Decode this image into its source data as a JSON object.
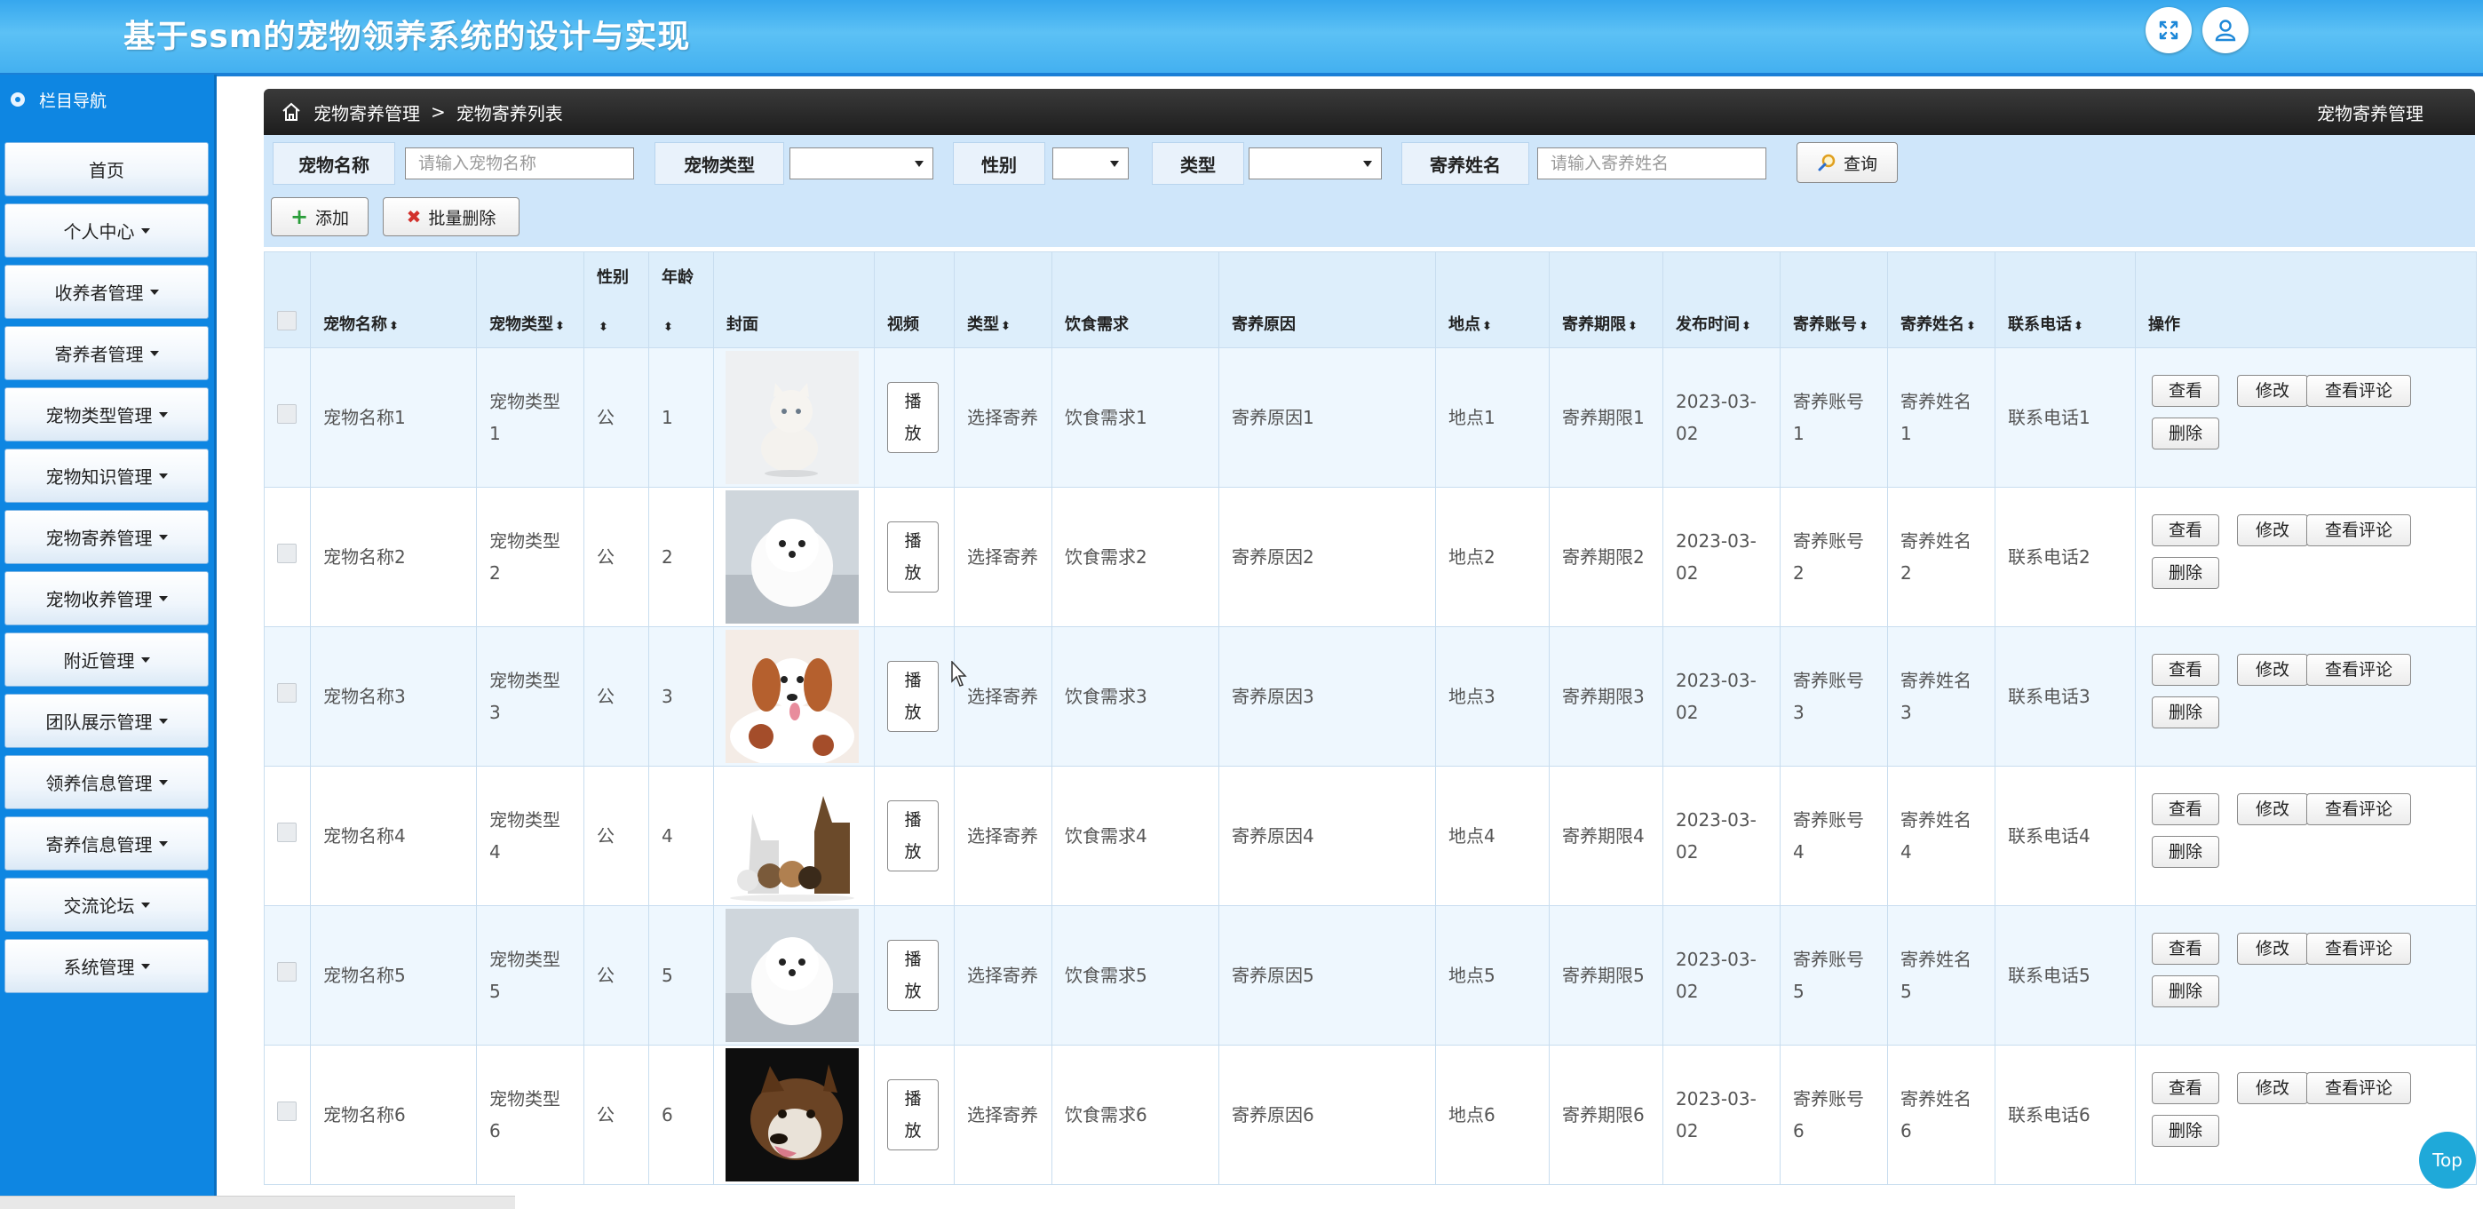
{
  "app": {
    "title": "基于ssm的宠物领养系统的设计与实现"
  },
  "sidebar": {
    "header": "栏目导航",
    "items": [
      {
        "label": "首页",
        "has_caret": false
      },
      {
        "label": "个人中心",
        "has_caret": true
      },
      {
        "label": "收养者管理",
        "has_caret": true
      },
      {
        "label": "寄养者管理",
        "has_caret": true
      },
      {
        "label": "宠物类型管理",
        "has_caret": true
      },
      {
        "label": "宠物知识管理",
        "has_caret": true
      },
      {
        "label": "宠物寄养管理",
        "has_caret": true
      },
      {
        "label": "宠物收养管理",
        "has_caret": true
      },
      {
        "label": "附近管理",
        "has_caret": true
      },
      {
        "label": "团队展示管理",
        "has_caret": true
      },
      {
        "label": "领养信息管理",
        "has_caret": true
      },
      {
        "label": "寄养信息管理",
        "has_caret": true
      },
      {
        "label": "交流论坛",
        "has_caret": true
      },
      {
        "label": "系统管理",
        "has_caret": true
      }
    ]
  },
  "breadcrumb": {
    "section": "宠物寄养管理",
    "separator": ">",
    "page": "宠物寄养列表",
    "right_title": "宠物寄养管理"
  },
  "search": {
    "pet_name_label": "宠物名称",
    "pet_name_placeholder": "请输入宠物名称",
    "pet_type_label": "宠物类型",
    "pet_type_value": "",
    "gender_label": "性别",
    "gender_value": "",
    "type_label": "类型",
    "type_value": "",
    "owner_name_label": "寄养姓名",
    "owner_name_placeholder": "请输入寄养姓名",
    "query_button": "查询"
  },
  "toolbar": {
    "add_button": "添加",
    "batch_delete_button": "批量删除"
  },
  "table": {
    "headers": {
      "pet_name": "宠物名称",
      "pet_type": "宠物类型",
      "gender": "性别",
      "age": "年龄",
      "cover": "封面",
      "video": "视频",
      "type": "类型",
      "diet": "饮食需求",
      "reason": "寄养原因",
      "location": "地点",
      "period": "寄养期限",
      "publish_time": "发布时间",
      "account": "寄养账号",
      "owner_name": "寄养姓名",
      "phone": "联系电话",
      "actions": "操作"
    },
    "sort_glyph": "⬍",
    "rows": [
      {
        "pet_name": "宠物名称1",
        "pet_type": "宠物类型1",
        "gender": "公",
        "age": "1",
        "video": "播放",
        "type": "选择寄养",
        "diet": "饮食需求1",
        "reason": "寄养原因1",
        "location": "地点1",
        "period": "寄养期限1",
        "publish_time": "2023-03-02",
        "account": "寄养账号1",
        "owner_name": "寄养姓名1",
        "phone": "联系电话1",
        "image": "white-cat"
      },
      {
        "pet_name": "宠物名称2",
        "pet_type": "宠物类型2",
        "gender": "公",
        "age": "2",
        "video": "播放",
        "type": "选择寄养",
        "diet": "饮食需求2",
        "reason": "寄养原因2",
        "location": "地点2",
        "period": "寄养期限2",
        "publish_time": "2023-03-02",
        "account": "寄养账号2",
        "owner_name": "寄养姓名2",
        "phone": "联系电话2",
        "image": "white-pomeranian"
      },
      {
        "pet_name": "宠物名称3",
        "pet_type": "宠物类型3",
        "gender": "公",
        "age": "3",
        "video": "播放",
        "type": "选择寄养",
        "diet": "饮食需求3",
        "reason": "寄养原因3",
        "location": "地点3",
        "period": "寄养期限3",
        "publish_time": "2023-03-02",
        "account": "寄养账号3",
        "owner_name": "寄养姓名3",
        "phone": "联系电话3",
        "image": "spaniel"
      },
      {
        "pet_name": "宠物名称4",
        "pet_type": "宠物类型4",
        "gender": "公",
        "age": "4",
        "video": "播放",
        "type": "选择寄养",
        "diet": "饮食需求4",
        "reason": "寄养原因4",
        "location": "地点4",
        "period": "寄养期限4",
        "publish_time": "2023-03-02",
        "account": "寄养账号4",
        "owner_name": "寄养姓名4",
        "phone": "联系电话4",
        "image": "dog-group"
      },
      {
        "pet_name": "宠物名称5",
        "pet_type": "宠物类型5",
        "gender": "公",
        "age": "5",
        "video": "播放",
        "type": "选择寄养",
        "diet": "饮食需求5",
        "reason": "寄养原因5",
        "location": "地点5",
        "period": "寄养期限5",
        "publish_time": "2023-03-02",
        "account": "寄养账号5",
        "owner_name": "寄养姓名5",
        "phone": "联系电话5",
        "image": "white-pomeranian"
      },
      {
        "pet_name": "宠物名称6",
        "pet_type": "宠物类型6",
        "gender": "公",
        "age": "6",
        "video": "播放",
        "type": "选择寄养",
        "diet": "饮食需求6",
        "reason": "寄养原因6",
        "location": "地点6",
        "period": "寄养期限6",
        "publish_time": "2023-03-02",
        "account": "寄养账号6",
        "owner_name": "寄养姓名6",
        "phone": "联系电话6",
        "image": "husky"
      }
    ],
    "row_actions": {
      "view": "查看",
      "edit": "修改",
      "view_comments": "查看评论",
      "delete": "删除"
    }
  },
  "top_button": "Top",
  "colors": {
    "header": "#43b0f0",
    "sidebar": "#0e86e2",
    "breadcrumb": "#1d1d1d",
    "search_panel": "#cfe6fa",
    "top_button": "#1fa9d9"
  }
}
